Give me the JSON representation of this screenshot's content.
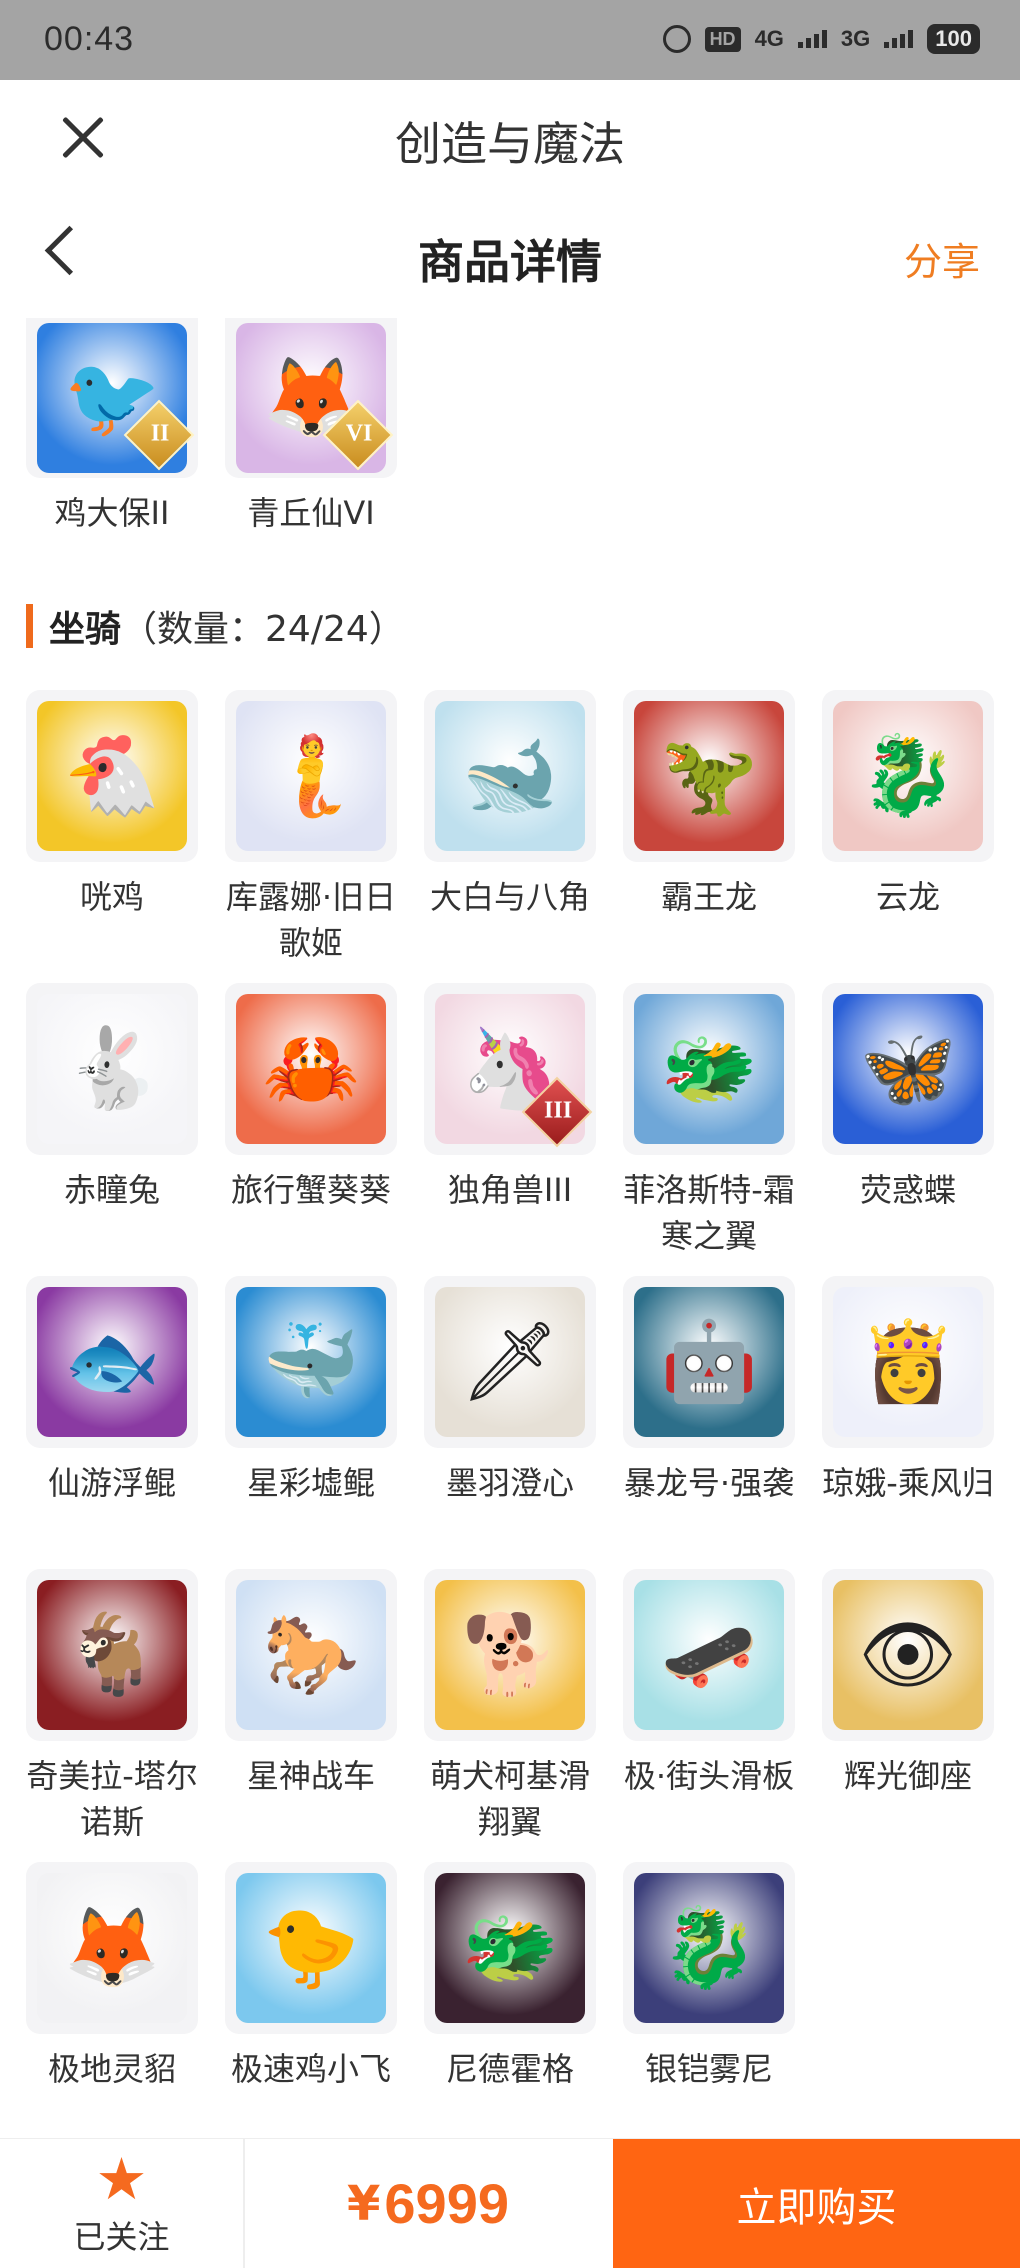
{
  "status_bar": {
    "time": "00:43",
    "hd": "HD",
    "net1": "4G",
    "net2": "3G",
    "battery": "100"
  },
  "app": {
    "title": "创造与魔法"
  },
  "nav": {
    "title": "商品详情",
    "share": "分享"
  },
  "top_items": [
    {
      "name": "鸡大保II",
      "badge": "II",
      "color": "#2f7fe0",
      "glyph": "🐦"
    },
    {
      "name": "青丘仙VI",
      "badge": "VI",
      "color": "#d9b6e6",
      "glyph": "🦊"
    }
  ],
  "mounts_section": {
    "label": "坐骑",
    "count": "（数量：24/24）"
  },
  "mounts": [
    {
      "name": "咣鸡",
      "color": "#f3c628",
      "glyph": "🐔"
    },
    {
      "name": "库露娜·旧日歌姬",
      "color": "#dfe3f4",
      "glyph": "🧜"
    },
    {
      "name": "大白与八角",
      "color": "#bfe0ee",
      "glyph": "🐋"
    },
    {
      "name": "霸王龙",
      "color": "#c8463c",
      "glyph": "🦖"
    },
    {
      "name": "云龙",
      "color": "#f0c8c4",
      "glyph": "🐉"
    },
    {
      "name": "赤瞳兔",
      "color": "#f5f5f8",
      "glyph": "🐇"
    },
    {
      "name": "旅行蟹葵葵",
      "color": "#ee6c4a",
      "glyph": "🦀"
    },
    {
      "name": "独角兽III",
      "color": "#f2d8e2",
      "glyph": "🦄",
      "badge": "III",
      "badge_style": "red"
    },
    {
      "name": "菲洛斯特-霜寒之翼",
      "color": "#6fa7d8",
      "glyph": "🐲"
    },
    {
      "name": "荧惑蝶",
      "color": "#2a5fd6",
      "glyph": "🦋"
    },
    {
      "name": "仙游浮鲲",
      "color": "#8a3aa2",
      "glyph": "🐟"
    },
    {
      "name": "星彩墟鲲",
      "color": "#2b8cd2",
      "glyph": "🐳"
    },
    {
      "name": "墨羽澄心",
      "color": "#e6e0d6",
      "glyph": "🗡"
    },
    {
      "name": "暴龙号·强袭",
      "color": "#2d6f8a",
      "glyph": "🤖"
    },
    {
      "name": "琼娥-乘风归",
      "color": "#eef0fa",
      "glyph": "👸"
    },
    {
      "name": "奇美拉-塔尔诺斯",
      "color": "#8a1e22",
      "glyph": "🐐"
    },
    {
      "name": "星神战车",
      "color": "#cfe0f4",
      "glyph": "🐎"
    },
    {
      "name": "萌犬柯基滑翔翼",
      "color": "#f3c04a",
      "glyph": "🐕"
    },
    {
      "name": "极·街头滑板",
      "color": "#a8e0e6",
      "glyph": "🛹"
    },
    {
      "name": "辉光御座",
      "color": "#e8c064",
      "glyph": "👁"
    },
    {
      "name": "极地灵貂",
      "color": "#f2f2f4",
      "glyph": "🦊"
    },
    {
      "name": "极速鸡小飞",
      "color": "#7cc8ee",
      "glyph": "🐤"
    },
    {
      "name": "尼德霍格",
      "color": "#3a2230",
      "glyph": "🐲"
    },
    {
      "name": "银铠雾尼",
      "color": "#3c3f7a",
      "glyph": "🐉"
    }
  ],
  "bottom": {
    "follow_label": "已关注",
    "currency": "¥",
    "price": "6999",
    "buy_label": "立即购买"
  }
}
